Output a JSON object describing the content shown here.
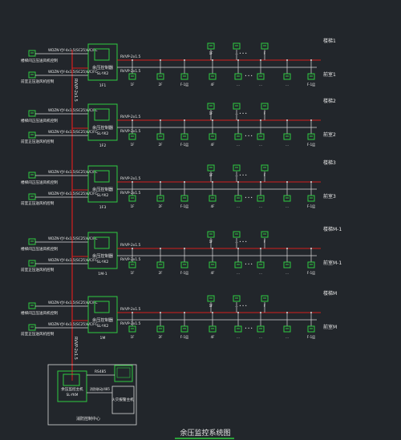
{
  "colors": {
    "background": "#22262b",
    "bus": "#d41e1e",
    "device": "#2ecc40",
    "text": "#e8e8e8",
    "frame": "#d9d9d9"
  },
  "title": "余压监控系统图",
  "trunk_label": "RVVP-2x1.5",
  "groups": [
    {
      "floor_label": "楼梯1",
      "front_label": "前室1",
      "cable_top": "WDZN-YJY-4x1.5(SC25)WC/FC",
      "cable_bottom": "WDZN-YJY-4x1.5(SC25)WC/FC",
      "left_top": "楼梯间正压送风机控制",
      "left_bottom": "前室正压送风机控制",
      "controller": "余压控制器 SL-YK2",
      "controller_sub": "1F1",
      "bus_top": "RVVP-2x1.5",
      "bus_bottom": "RVVP-2x1.5",
      "sensors_top": [
        "1F",
        "…",
        "F"
      ],
      "sensors_bottom": [
        "1F",
        "2F",
        "F-1层",
        "4F",
        "…",
        "…",
        "…",
        "F-1层",
        "F层"
      ]
    },
    {
      "floor_label": "楼梯2",
      "front_label": "前室2",
      "cable_top": "WDZN-YJY-4x1.5(SC25)WC/FC",
      "cable_bottom": "WDZN-YJY-4x1.5(SC25)WC/FC",
      "left_top": "楼梯间正压送风机控制",
      "left_bottom": "前室正压送风机控制",
      "controller": "余压控制器 SL-YK2",
      "controller_sub": "1F2",
      "bus_top": "RVVP-2x1.5",
      "bus_bottom": "RVVP-2x1.5",
      "sensors_top": [
        "1F",
        "…",
        "F"
      ],
      "sensors_bottom": [
        "1F",
        "2F",
        "F-1层",
        "4F",
        "…",
        "…",
        "…",
        "F-1层",
        "F层"
      ]
    },
    {
      "floor_label": "楼梯3",
      "front_label": "前室3",
      "cable_top": "WDZN-YJY-4x1.5(SC25)WC/FC",
      "cable_bottom": "WDZN-YJY-4x1.5(SC25)WC/FC",
      "left_top": "楼梯间正压送风机控制",
      "left_bottom": "前室正压送风机控制",
      "controller": "余压控制器 SL-YK2",
      "controller_sub": "1F3",
      "bus_top": "RVVP-2x1.5",
      "bus_bottom": "RVVP-2x1.5",
      "sensors_top": [
        "1F",
        "…",
        "F"
      ],
      "sensors_bottom": [
        "1F",
        "2F",
        "F-1层",
        "4F",
        "…",
        "…",
        "…",
        "F-1层",
        "F层"
      ]
    },
    {
      "floor_label": "楼梯M-1",
      "front_label": "前室M-1",
      "cable_top": "WDZN-YJY-4x1.5(SC25)WC/FC",
      "cable_bottom": "WDZN-YJY-4x1.5(SC25)WC/FC",
      "left_top": "楼梯间正压送风机控制",
      "left_bottom": "前室正压送风机控制",
      "controller": "余压控制器 SL-YK2",
      "controller_sub": "1M-1",
      "bus_top": "RVVP-2x1.5",
      "bus_bottom": "RVVP-2x1.5",
      "sensors_top": [
        "1F",
        "…",
        "F"
      ],
      "sensors_bottom": [
        "1F",
        "2F",
        "F-1层",
        "4F",
        "…",
        "…",
        "…",
        "F-1层",
        "F层"
      ]
    },
    {
      "floor_label": "楼梯M",
      "front_label": "前室M",
      "cable_top": "WDZN-YJY-4x1.5(SC25)WC/FC",
      "cable_bottom": "WDZN-YJY-4x1.5(SC25)WC/FC",
      "left_top": "楼梯间正压送风机控制",
      "left_bottom": "前室正压送风机控制",
      "controller": "余压控制器 SL-YK2",
      "controller_sub": "1M",
      "bus_top": "RVVP-2x1.5",
      "bus_bottom": "RVVP-2x1.5",
      "sensors_top": [
        "1F",
        "…",
        "F"
      ],
      "sensors_bottom": [
        "1F",
        "2F",
        "F-1层",
        "4F",
        "…",
        "…",
        "…",
        "F-1层",
        "F层"
      ]
    }
  ],
  "control_center": {
    "label": "消防控制中心",
    "host": "余压监控主机 SL-YKM",
    "link_label": "RS485",
    "panel_label": "火灾报警主机",
    "link2_label": "消防联动/485"
  }
}
